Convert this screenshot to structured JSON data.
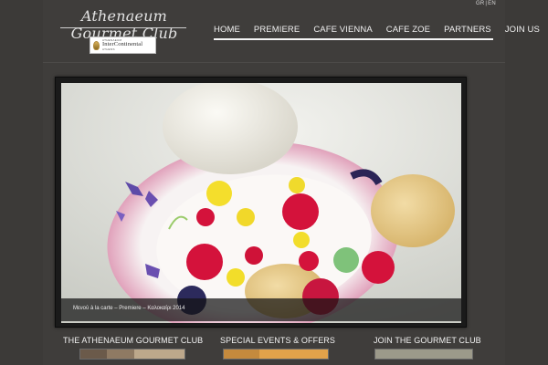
{
  "header": {
    "lang": {
      "gr": "GR",
      "sep": "|",
      "en": "EN"
    },
    "logo_script": "Athenaeum Gourmet Club",
    "partner_logo": {
      "small_top": "ATHENAEUM",
      "brand": "InterContinental",
      "small_bottom": "ATHENS"
    }
  },
  "nav": {
    "items": [
      {
        "label": "HOME",
        "active": true
      },
      {
        "label": "PREMIERE",
        "active": false
      },
      {
        "label": "CAFE VIENNA",
        "active": false
      },
      {
        "label": "CAFE ZOE",
        "active": false
      },
      {
        "label": "PARTNERS",
        "active": false
      },
      {
        "label": "JOIN US",
        "active": false
      }
    ]
  },
  "slider": {
    "caption": "Μενού à la carte – Premiere – Καλοκαίρι 2014",
    "image_subject": "plated-dessert-photo"
  },
  "features": [
    {
      "title": "THE ATHENAEUM GOURMET CLUB"
    },
    {
      "title": "SPECIAL EVENTS & OFFERS"
    },
    {
      "title": "JOIN THE GOURMET CLUB"
    }
  ],
  "colors": {
    "background": "#3c3a38",
    "panel": "#3f3d3b",
    "text": "#f0f0f0",
    "slider_frame": "#1a1a1a"
  }
}
